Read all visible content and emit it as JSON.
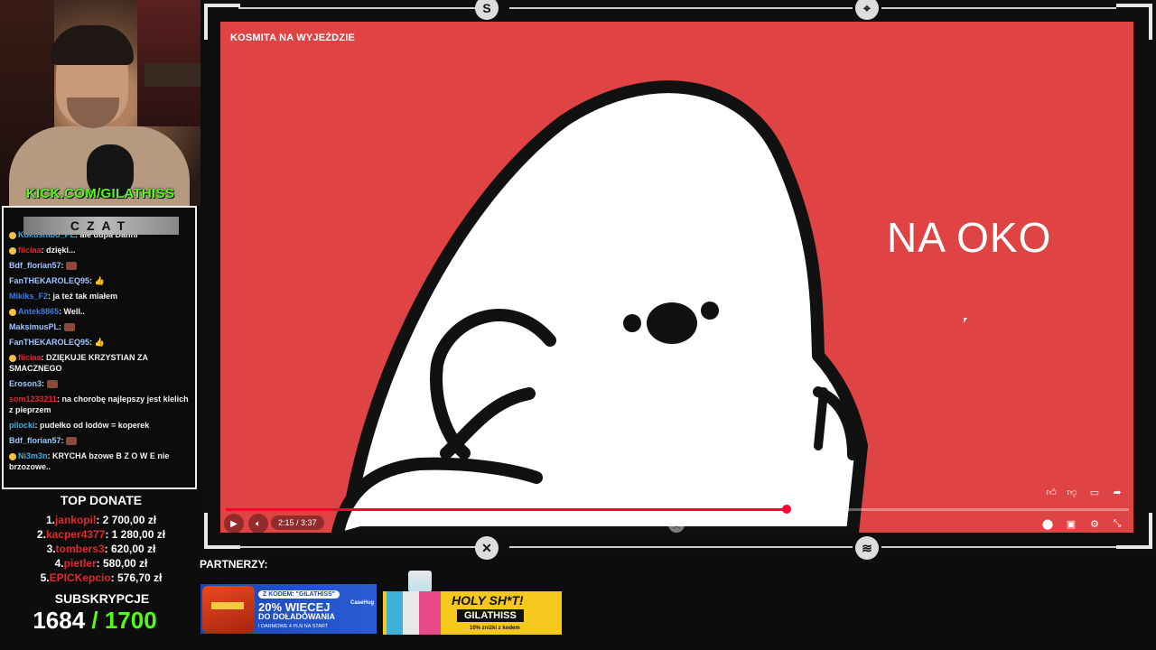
{
  "webcam": {
    "channel_url": "KICK.COM/GILATHISS"
  },
  "chat": {
    "title": "CZAT",
    "messages": [
      {
        "user": "Kokushibo_PL",
        "text": "ale dupa Danni",
        "color": "#3ab0e2",
        "badge": true,
        "emote": false
      },
      {
        "user": "fiiciaa",
        "text": "dzięki...",
        "color": "#e3262c",
        "badge": true,
        "emote": false
      },
      {
        "user": "Bdf_florian57",
        "text": "",
        "color": "#9fc5ff",
        "badge": false,
        "emote": true
      },
      {
        "user": "FanTHEKAROLEQ95",
        "text": "👍",
        "color": "#9fc5ff",
        "badge": false,
        "emote": false
      },
      {
        "user": "Mikiks_F2",
        "text": "ja też tak miałem",
        "color": "#3a7ce2",
        "badge": false,
        "emote": false
      },
      {
        "user": "Antek8865",
        "text": "Well..",
        "color": "#3a7ce2",
        "badge": true,
        "emote": false
      },
      {
        "user": "MaksimusPL",
        "text": "",
        "color": "#9fc5ff",
        "badge": false,
        "emote": true
      },
      {
        "user": "FanTHEKAROLEQ95",
        "text": "👍",
        "color": "#9fc5ff",
        "badge": false,
        "emote": false
      },
      {
        "user": "fiiciaa",
        "text": "DZIĘKUJE KRZYSTIAN ZA SMACZNEGO",
        "color": "#e3262c",
        "badge": true,
        "emote": false
      },
      {
        "user": "Eroson3",
        "text": "",
        "color": "#9fc5ff",
        "badge": false,
        "emote": true
      },
      {
        "user": "som1233211",
        "text": "na chorobę najlepszy jest klelich z pieprzem",
        "color": "#e3262c",
        "badge": false,
        "emote": false
      },
      {
        "user": "pilocki",
        "text": "pudełko od lodów = koperek",
        "color": "#3ab0e2",
        "badge": false,
        "emote": false
      },
      {
        "user": "Bdf_florian57",
        "text": "",
        "color": "#9fc5ff",
        "badge": false,
        "emote": true
      },
      {
        "user": "Ni3m3n",
        "text": "KRYCHA bzowe B Z O W E nie brzozowe..",
        "color": "#3ab0e2",
        "badge": true,
        "emote": false
      }
    ]
  },
  "donations": {
    "title": "TOP DONATE",
    "items": [
      {
        "rank": "1.",
        "name": "jankopil",
        "amount": "2 700,00 zł"
      },
      {
        "rank": "2.",
        "name": "kacper4377",
        "amount": "1 280,00 zł"
      },
      {
        "rank": "3.",
        "name": "tombers3",
        "amount": "620,00 zł"
      },
      {
        "rank": "4.",
        "name": "pietler",
        "amount": "580,00 zł"
      },
      {
        "rank": "5.",
        "name": "EPICKepcio",
        "amount": "576,70 zł"
      }
    ]
  },
  "subs": {
    "title": "SUBSKRYPCJE",
    "current": "1684",
    "goal": "/ 1700"
  },
  "video": {
    "title": "KOSMITA NA WYJEŻDZIE",
    "overlay_text": "NA OKO",
    "time": "2:15 / 3:37",
    "progress": 0.621,
    "background_color": "#e04343"
  },
  "partners": {
    "label": "PARTNERZY:",
    "case_banner": {
      "code": "Z KODEM: \"GILATHISS\"",
      "headline": "20% WIĘCEJ",
      "line2": "DO DOŁADOWANIA",
      "line3": "I DARMOWE 4 PLN NA START",
      "brand": "CaseHug"
    },
    "holy_banner": {
      "headline": "HOLY SH*T!",
      "code": "GILATHISS",
      "sub": "10% zniżki z kodem"
    }
  },
  "icons": {
    "play": "play-icon",
    "volume": "volume-icon",
    "like": "thumbs-up-icon",
    "dislike": "thumbs-down-icon",
    "comment": "comment-icon",
    "share": "share-icon",
    "autoplay": "toggle-icon",
    "subtitles": "subtitles-icon",
    "settings": "gear-icon",
    "exit_fullscreen": "collapse-icon"
  }
}
